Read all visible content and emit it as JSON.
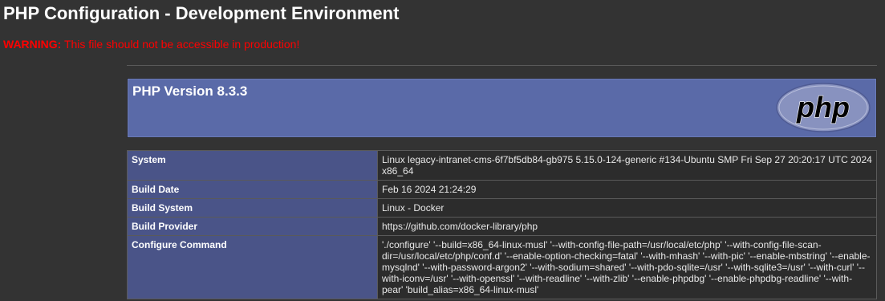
{
  "page": {
    "title": "PHP Configuration - Development Environment",
    "warning_label": "WARNING:",
    "warning_text": "This file should not be accessible in production!"
  },
  "header": {
    "version": "PHP Version 8.3.3",
    "logo_text": "php"
  },
  "info_table": {
    "rows": [
      {
        "key": "System",
        "value": "Linux legacy-intranet-cms-6f7bf5db84-gb975 5.15.0-124-generic #134-Ubuntu SMP Fri Sep 27 20:20:17 UTC 2024 x86_64"
      },
      {
        "key": "Build Date",
        "value": "Feb 16 2024 21:24:29"
      },
      {
        "key": "Build System",
        "value": "Linux - Docker"
      },
      {
        "key": "Build Provider",
        "value": "https://github.com/docker-library/php"
      },
      {
        "key": "Configure Command",
        "value": "'./configure' '--build=x86_64-linux-musl' '--with-config-file-path=/usr/local/etc/php' '--with-config-file-scan-dir=/usr/local/etc/php/conf.d' '--enable-option-checking=fatal' '--with-mhash' '--with-pic' '--enable-mbstring' '--enable-mysqlnd' '--with-password-argon2' '--with-sodium=shared' '--with-pdo-sqlite=/usr' '--with-sqlite3=/usr' '--with-curl' '--with-iconv=/usr' '--with-openssl' '--with-readline' '--with-zlib' '--enable-phpdbg' '--enable-phpdbg-readline' '--with-pear' 'build_alias=x86_64-linux-musl'"
      }
    ]
  },
  "colors": {
    "background": "#333333",
    "warning": "#ff0000",
    "header_bg": "#5a6aa8",
    "key_cell_bg": "#4a5488",
    "value_cell_bg": "#2c2c2c",
    "logo_bg": "#8892bf"
  }
}
